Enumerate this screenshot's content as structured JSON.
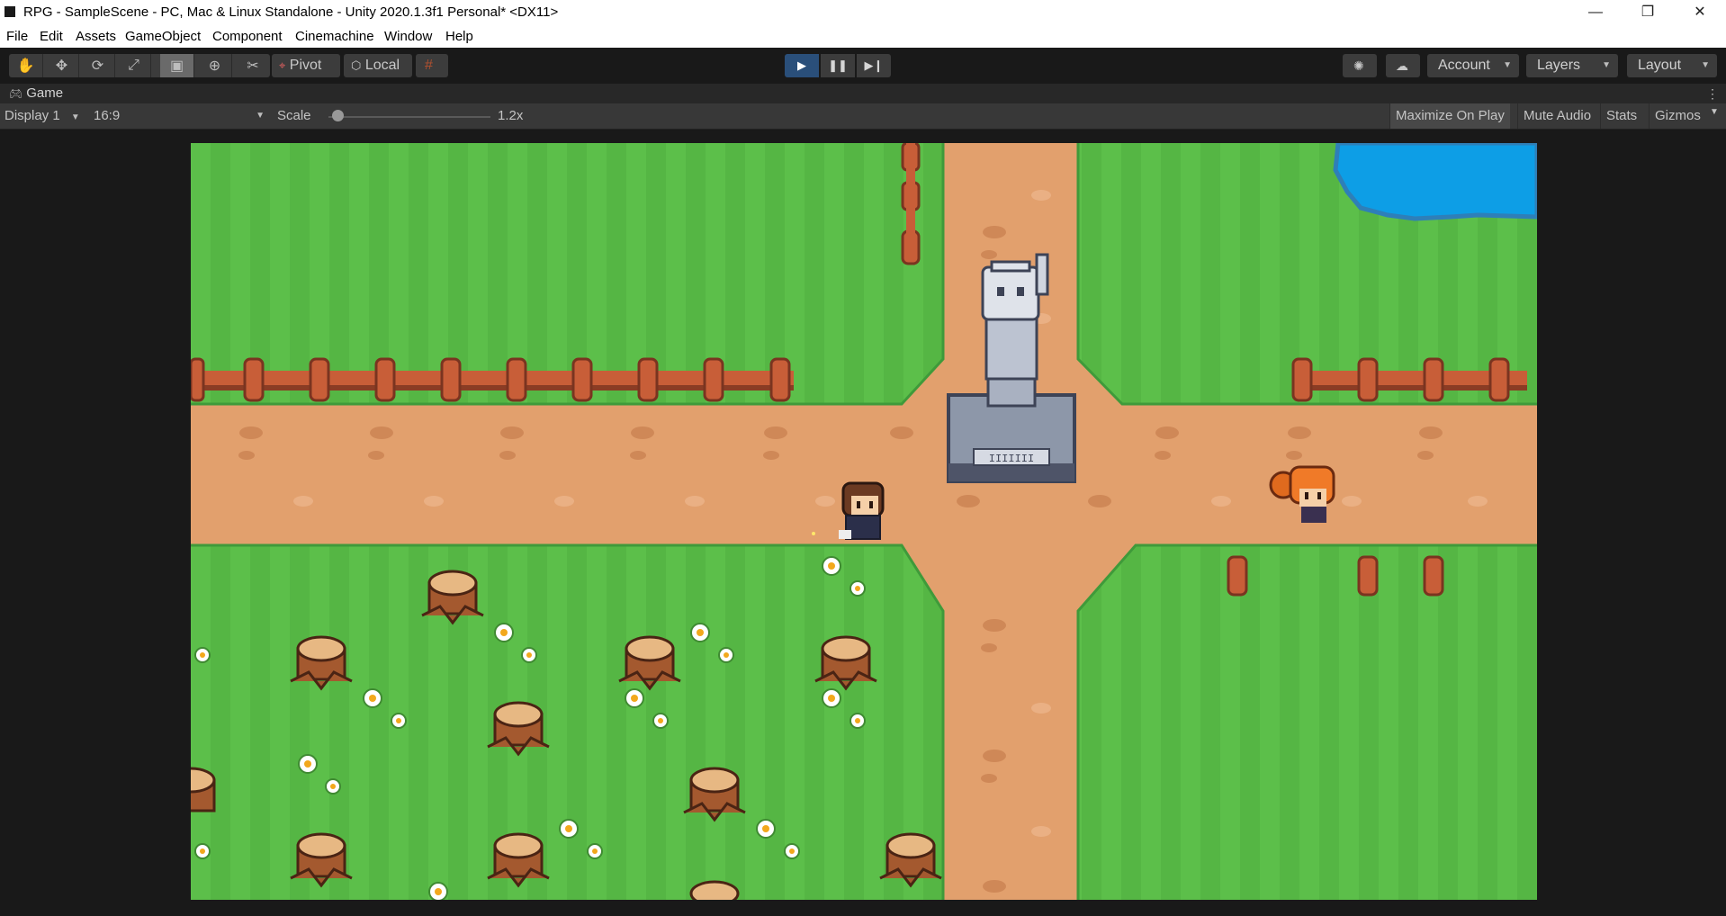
{
  "window": {
    "title": "RPG - SampleScene - PC, Mac & Linux Standalone - Unity 2020.1.3f1 Personal* <DX11>",
    "minimize_glyph": "—",
    "restore_glyph": "❐",
    "close_glyph": "✕"
  },
  "menu": [
    "File",
    "Edit",
    "Assets",
    "GameObject",
    "Component",
    "Cinemachine",
    "Window",
    "Help"
  ],
  "toolbar": {
    "tools": [
      "hand-tool-icon",
      "move-tool-icon",
      "rotate-tool-icon",
      "scale-tool-icon",
      "rect-tool-icon",
      "transform-tool-icon",
      "custom-tool-icon"
    ],
    "active_tool": "rect-tool-icon",
    "pivot_label": "Pivot",
    "local_label": "Local",
    "play_state": "playing",
    "account_label": "Account",
    "layers_label": "Layers",
    "layout_label": "Layout"
  },
  "game_tab": {
    "label": "Game"
  },
  "game_toolbar": {
    "display": "Display 1",
    "aspect": "16:9",
    "scale_label": "Scale",
    "scale_value": "1.2x",
    "scale_fraction": 0.03,
    "maximize_on_play": "Maximize On Play",
    "mute_audio": "Mute Audio",
    "stats": "Stats",
    "gizmos": "Gizmos"
  },
  "colors": {
    "grass": "#5cbf4a",
    "grass_stripe": "#55b644",
    "path": "#e2a06d",
    "water": "#0d9ee6",
    "editor_dark": "#191919",
    "play_active": "#2a4f7a"
  },
  "scene": {
    "statue_plaque": "IIIIIII"
  }
}
